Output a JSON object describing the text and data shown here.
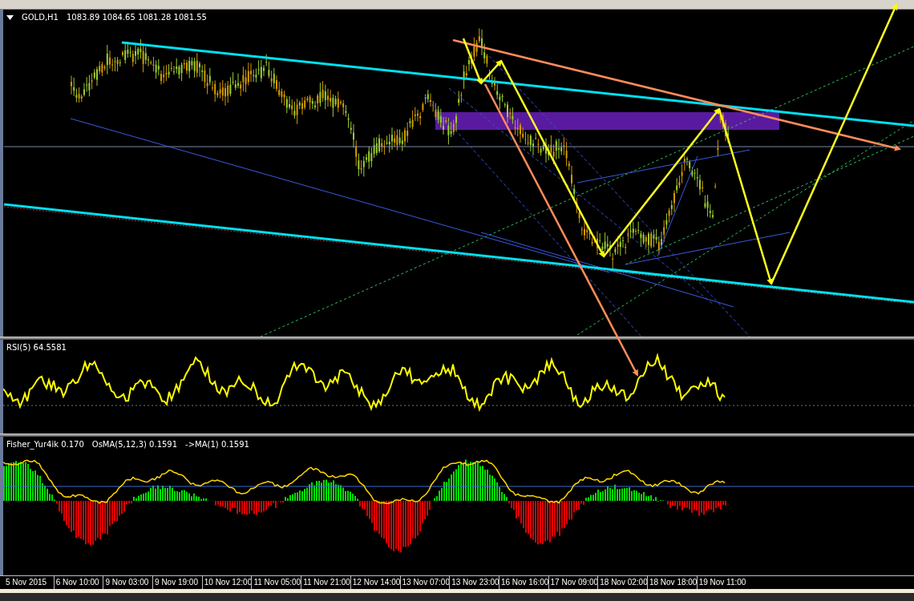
{
  "main_chart": {
    "symbol": "GOLD,H1",
    "quote": "1083.89 1084.65 1081.28 1081.55"
  },
  "rsi_panel": {
    "label": "RSI(5) 64.5581"
  },
  "fisher_panel": {
    "labels": [
      "Fisher_Yur4ik 0.170",
      "OsMA(5,12,3) 0.1591",
      "->MA(1) 0.1591"
    ]
  },
  "time_axis": {
    "labels": [
      "5 Nov 2015",
      "6 Nov 10:00",
      "9 Nov 03:00",
      "9 Nov 19:00",
      "10 Nov 12:00",
      "11 Nov 05:00",
      "11 Nov 21:00",
      "12 Nov 14:00",
      "13 Nov 07:00",
      "13 Nov 23:00",
      "16 Nov 16:00",
      "17 Nov 09:00",
      "18 Nov 02:00",
      "18 Nov 18:00",
      "19 Nov 11:00"
    ]
  }
}
